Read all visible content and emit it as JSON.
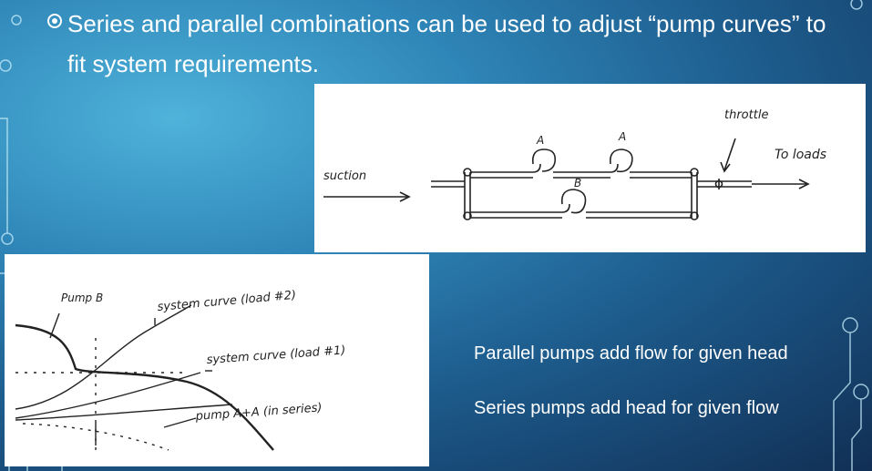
{
  "slide": {
    "bullet": "Series and parallel combinations can be used to adjust “pump curves” to fit system requirements.",
    "caption_parallel": "Parallel pumps add flow for given head",
    "caption_series": "Series pumps add head for given flow"
  },
  "schematic": {
    "suction_label": "suction",
    "pump_a1_label": "A",
    "pump_a2_label": "A",
    "pump_b_label": "B",
    "throttle_label": "throttle",
    "loads_label": "To loads"
  },
  "curves": {
    "pump_b_label": "Pump B",
    "system_curve_2_label": "system curve (load #2)",
    "system_curve_1_label": "system curve (load #1)",
    "series_label": "pump A+A (in series)"
  },
  "colors": {
    "accent": "#ffffff",
    "background_dark": "#112f55",
    "background_light": "#4fb3da"
  }
}
